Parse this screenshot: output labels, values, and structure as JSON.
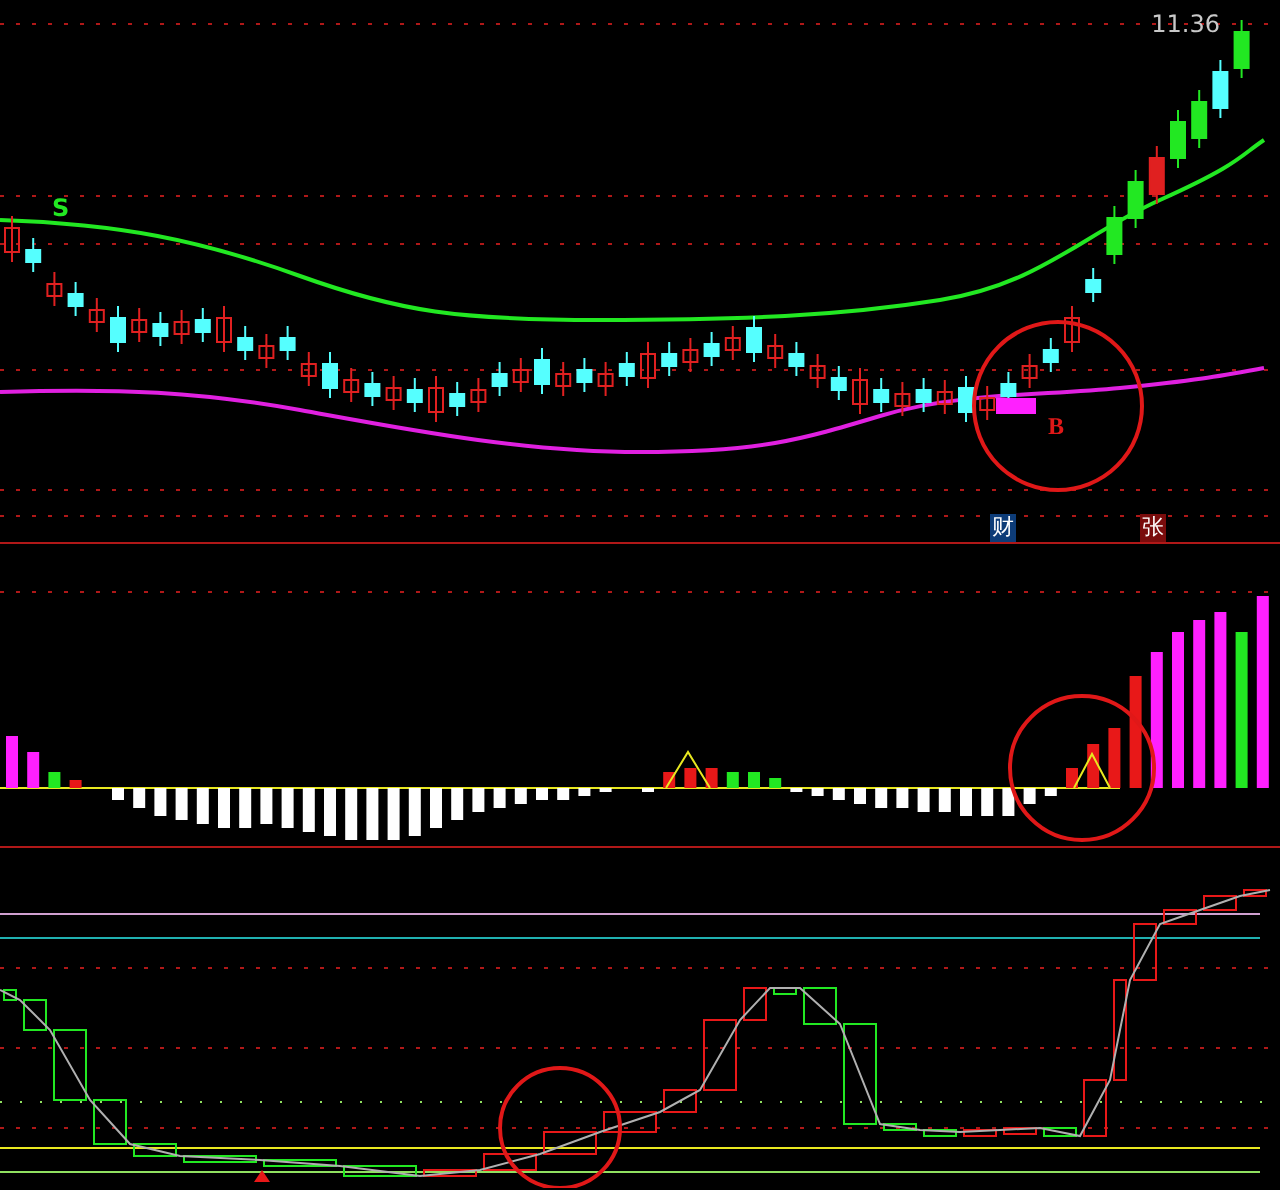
{
  "price_chart": {
    "price_label": "11.36",
    "signals": [
      {
        "kind": "sell",
        "label": "S"
      },
      {
        "kind": "buy",
        "label": "B"
      }
    ],
    "badges": [
      {
        "label": "财",
        "color": "#0d3c78"
      },
      {
        "label": "张",
        "color": "#7a0c0c"
      }
    ]
  }
}
